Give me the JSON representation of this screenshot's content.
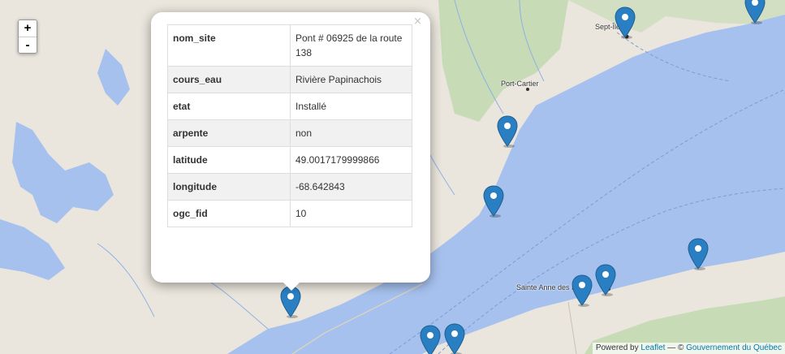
{
  "map": {
    "zoom_in_label": "+",
    "zoom_out_label": "-",
    "place_labels": [
      "Sept-Îles",
      "Port-Cartier",
      "Sainte Anne des Monts"
    ],
    "marker_icon": "map-pin-icon",
    "marker_color": "#2a7fc2",
    "water_color": "#a6c1ee",
    "land_color": "#eae6dd",
    "forest_color": "#c7dbb7"
  },
  "popup": {
    "close_label": "×",
    "rows": [
      {
        "key": "nom_site",
        "value": "Pont # 06925 de la route 138"
      },
      {
        "key": "cours_eau",
        "value": "Rivière Papinachois"
      },
      {
        "key": "etat",
        "value": "Installé"
      },
      {
        "key": "arpente",
        "value": "non"
      },
      {
        "key": "latitude",
        "value": "49.0017179999866"
      },
      {
        "key": "longitude",
        "value": "-68.642843"
      },
      {
        "key": "ogc_fid",
        "value": "10"
      }
    ]
  },
  "attribution": {
    "prefix": "Powered by ",
    "leaflet_link": "Leaflet",
    "separator": " — © ",
    "source_link": "Gouvernement du Québec"
  }
}
